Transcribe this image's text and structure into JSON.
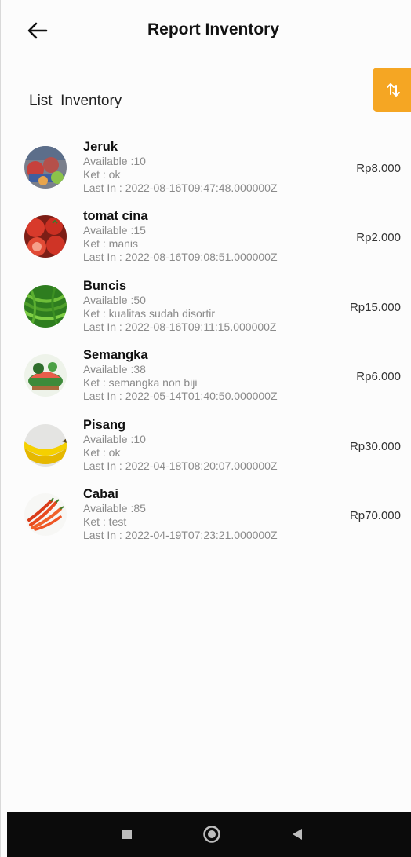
{
  "header": {
    "title": "Report Inventory",
    "back_icon": "arrow-left-icon"
  },
  "section": {
    "title": "List  Inventory",
    "sort_icon": "sort-arrows-icon",
    "sort_color": "#f5a623"
  },
  "items": [
    {
      "name": "Jeruk",
      "available": "Available :10",
      "ket": "Ket : ok",
      "last_in": "Last In : 2022-08-16T09:47:48.000000Z",
      "price": "Rp8.000"
    },
    {
      "name": "tomat cina",
      "available": "Available :15",
      "ket": "Ket : manis",
      "last_in": "Last In : 2022-08-16T09:08:51.000000Z",
      "price": "Rp2.000"
    },
    {
      "name": "Buncis",
      "available": "Available :50",
      "ket": "Ket : kualitas sudah disortir",
      "last_in": "Last In : 2022-08-16T09:11:15.000000Z",
      "price": "Rp15.000"
    },
    {
      "name": "Semangka",
      "available": "Available :38",
      "ket": "Ket : semangka non biji",
      "last_in": "Last In : 2022-05-14T01:40:50.000000Z",
      "price": "Rp6.000"
    },
    {
      "name": "Pisang",
      "available": "Available :10",
      "ket": "Ket : ok",
      "last_in": "Last In : 2022-04-18T08:20:07.000000Z",
      "price": "Rp30.000"
    },
    {
      "name": "Cabai",
      "available": "Available :85",
      "ket": "Ket : test",
      "last_in": "Last In : 2022-04-19T07:23:21.000000Z",
      "price": "Rp70.000"
    }
  ],
  "nav": {
    "recent_icon": "square-icon",
    "home_icon": "circle-icon",
    "back_icon": "triangle-back-icon"
  }
}
